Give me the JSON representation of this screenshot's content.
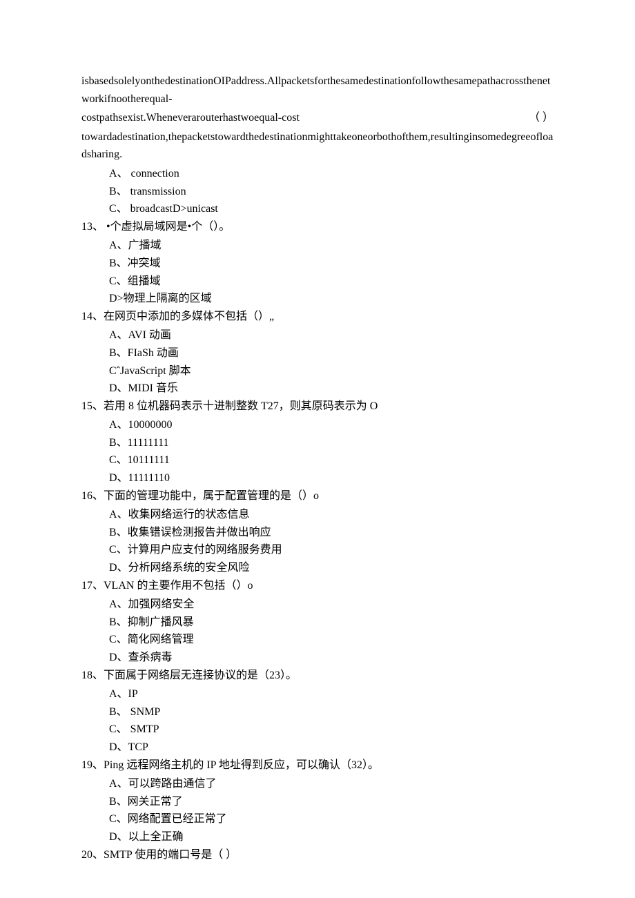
{
  "p1": "isbasedsolelyonthedestinationOIPaddress.Allpacketsforthesamedestinationfollowthesamepathacrossthenetworkifnootherequal-",
  "p2a": "costpathsexist.Wheneverarouterhastwoequal-cost",
  "p2b": "（     ）",
  "p3": "towardadestination,thepacketstowardthedestinationmighttakeoneorbothofthem,resultinginsomedegreeofloadsharing.",
  "q12": {
    "A": "A、 connection",
    "B": "B、 transmission",
    "C": "C、 broadcastD>unicast"
  },
  "q13": {
    "stem": "13、 •个虚拟局域网是•个（）。",
    "A": "A、广播域",
    "B": "B、冲突域",
    "C": "C、组播域",
    "D": "D>物理上隔离的区域"
  },
  "q14": {
    "stem": "14、在网页中添加的多媒体不包括（）„",
    "A": "A、AVI 动画",
    "B": "B、FIaSh 动画",
    "C": "CˆJavaScript 脚本",
    "D": "D、MIDI 音乐"
  },
  "q15": {
    "stem": "15、若用 8 位机器码表示十进制整数 T27，则其原码表示为 O",
    "A": "A、10000000",
    "B": "B、11111111",
    "C": "C、10111111",
    "D": "D、11111110"
  },
  "q16": {
    "stem": "16、下面的管理功能中，属于配置管理的是（）o",
    "A": "A、收集网络运行的状态信息",
    "B": "B、收集错误检测报告并做出响应",
    "C": "C、计算用户应支付的网络服务费用",
    "D": "D、分析网络系统的安全风险"
  },
  "q17": {
    "stem": "17、VLAN 的主要作用不包括（）o",
    "A": "A、加强网络安全",
    "B": "B、抑制广播风暴",
    "C": "C、简化网络管理",
    "D": "D、查杀病毒"
  },
  "q18": {
    "stem": "18、下面属于网络层无连接协议的是（23）。",
    "A": "A、IP",
    "B": "B、 SNMP",
    "C": "C、 SMTP",
    "D": "D、TCP"
  },
  "q19": {
    "stem": "19、Ping 远程网络主机的 IP 地址得到反应，可以确认（32）。",
    "A": "A、可以跨路由通信了",
    "B": "B、网关正常了",
    "C": "C、网络配置已经正常了",
    "D": "D、以上全正确"
  },
  "q20": {
    "stem": "20、SMTP 使用的端口号是（ ）"
  }
}
